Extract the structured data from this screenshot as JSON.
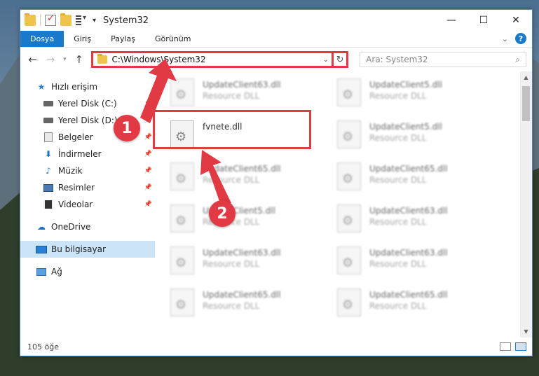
{
  "window": {
    "title": "System32",
    "controls": {
      "minimize": "—",
      "maximize": "☐",
      "close": "✕"
    }
  },
  "ribbon": {
    "tabs": [
      {
        "label": "Dosya",
        "active": true
      },
      {
        "label": "Giriş"
      },
      {
        "label": "Paylaş"
      },
      {
        "label": "Görünüm"
      }
    ],
    "help": "?"
  },
  "nav": {
    "address": "C:\\Windows\\System32",
    "search_placeholder": "Ara: System32"
  },
  "sidebar": {
    "quick_access": "Hızlı erişim",
    "items": [
      {
        "label": "Yerel Disk (C:)",
        "icon": "drive-icon"
      },
      {
        "label": "Yerel Disk (D:)",
        "icon": "drive-icon"
      },
      {
        "label": "Belgeler",
        "icon": "documents-icon"
      },
      {
        "label": "İndirmeler",
        "icon": "download-icon"
      },
      {
        "label": "Müzik",
        "icon": "music-icon"
      },
      {
        "label": "Resimler",
        "icon": "pictures-icon"
      },
      {
        "label": "Videolar",
        "icon": "videos-icon"
      }
    ],
    "onedrive": "OneDrive",
    "this_pc": "Bu bilgisayar",
    "network": "Ağ"
  },
  "files": [
    {
      "name": "UpdateClient63.dll",
      "desc": "Resource DLL"
    },
    {
      "name": "UpdateClient5.dll",
      "desc": "Resource DLL"
    },
    {
      "name": "fvnete.dll",
      "desc": ""
    },
    {
      "name": "UpdateClient5.dll",
      "desc": "Resource DLL"
    },
    {
      "name": "UpdateClient65.dll",
      "desc": "Resource DLL"
    },
    {
      "name": "UpdateClient65.dll",
      "desc": "Resource DLL"
    },
    {
      "name": "UpdateClient5.dll",
      "desc": "Resource DLL"
    },
    {
      "name": "UpdateClient63.dll",
      "desc": "Resource DLL"
    },
    {
      "name": "UpdateClient63.dll",
      "desc": "Resource DLL"
    },
    {
      "name": "UpdateClient63.dll",
      "desc": "Resource DLL"
    },
    {
      "name": "UpdateClient65.dll",
      "desc": "Resource DLL"
    },
    {
      "name": "UpdateClient65.dll",
      "desc": "Resource DLL"
    }
  ],
  "status": {
    "count": "105 öğe"
  },
  "annotations": {
    "step1": "1",
    "step2": "2",
    "color": "#e23a45"
  }
}
